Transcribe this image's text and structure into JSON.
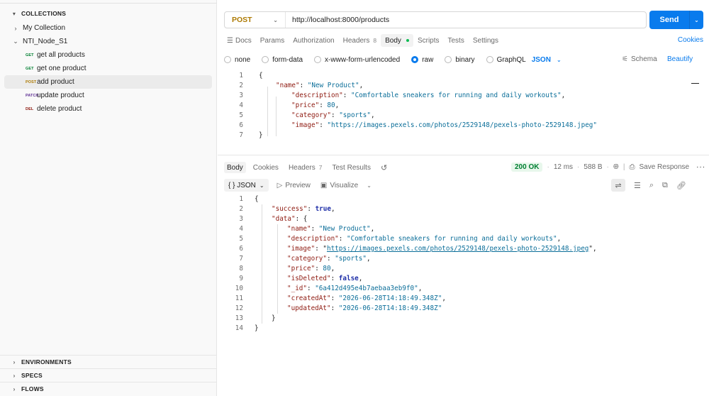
{
  "sidebar": {
    "collections_label": "COLLECTIONS",
    "items": [
      {
        "label": "My Collection"
      },
      {
        "label": "NTI_Node_S1"
      }
    ],
    "requests": [
      {
        "method": "GET",
        "label": "get all products"
      },
      {
        "method": "GET",
        "label": "get one product"
      },
      {
        "method": "POST",
        "label": "add product"
      },
      {
        "method": "PATCH",
        "label": "update product"
      },
      {
        "method": "DEL",
        "label": "delete product"
      }
    ],
    "environments_label": "ENVIRONMENTS",
    "specs_label": "SPECS",
    "flows_label": "FLOWS"
  },
  "request": {
    "method": "POST",
    "url": "http://localhost:8000/products",
    "send_label": "Send"
  },
  "tabs": {
    "docs": "Docs",
    "params": "Params",
    "authorization": "Authorization",
    "headers": "Headers",
    "headers_count": "8",
    "body": "Body",
    "scripts": "Scripts",
    "tests": "Tests",
    "settings": "Settings",
    "cookies": "Cookies"
  },
  "body_options": {
    "none": "none",
    "form_data": "form-data",
    "urlencoded": "x-www-form-urlencoded",
    "raw": "raw",
    "binary": "binary",
    "graphql": "GraphQL",
    "format": "JSON",
    "schema": "Schema",
    "beautify": "Beautify"
  },
  "request_body_lines": [
    "1",
    "2",
    "3",
    "4",
    "5",
    "6",
    "7"
  ],
  "request_body": {
    "name": "\"New Product\"",
    "description": "\"Comfortable sneakers for running and daily workouts\"",
    "price": "80",
    "category": "\"sports\"",
    "image": "\"https://images.pexels.com/photos/2529148/pexels-photo-2529148.jpeg\""
  },
  "response_tabs": {
    "body": "Body",
    "cookies": "Cookies",
    "headers": "Headers",
    "headers_count": "7",
    "test_results": "Test Results"
  },
  "response_meta": {
    "status": "200 OK",
    "time": "12 ms",
    "size": "588 B",
    "save_response": "Save Response"
  },
  "response_toolbar": {
    "format": "{ } JSON",
    "preview": "Preview",
    "visualize": "Visualize"
  },
  "response_lines": [
    "1",
    "2",
    "3",
    "4",
    "5",
    "6",
    "7",
    "8",
    "9",
    "10",
    "11",
    "12",
    "13",
    "14"
  ],
  "response_body": {
    "success": "true",
    "name": "\"New Product\"",
    "description": "\"Comfortable sneakers for running and daily workouts\"",
    "image": "https://images.pexels.com/photos/2529148/pexels-photo-2529148.jpeg",
    "category": "\"sports\"",
    "price": "80",
    "isDeleted": "false",
    "_id": "\"6a412d495e4b7aebaa3eb9f0\"",
    "createdAt": "\"2026-06-28T14:18:49.348Z\"",
    "updatedAt": "\"2026-06-28T14:18:49.348Z\""
  }
}
